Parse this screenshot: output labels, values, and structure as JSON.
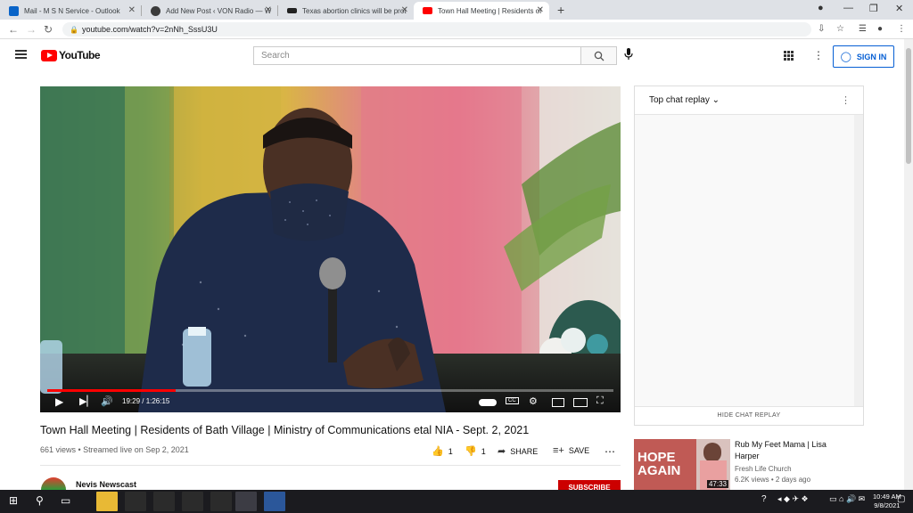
{
  "browser": {
    "tabs": [
      {
        "title": "Mail - M S N Service - Outlook",
        "color": "#0a64c8",
        "active": false
      },
      {
        "title": "Add New Post ‹ VON Radio — W",
        "color": "#3b3b3b",
        "active": false
      },
      {
        "title": "Texas abortion clinics will be prot",
        "color": "#222222",
        "active": false
      },
      {
        "title": "Town Hall Meeting | Residents of",
        "color": "#ff0000",
        "active": true
      }
    ],
    "url": "youtube.com/watch?v=2nNh_SssU3U"
  },
  "youtube": {
    "logo_text": "YouTube",
    "search_placeholder": "Search",
    "signin_label": "SIGN IN"
  },
  "player": {
    "time_display": "19:29 / 1:26:15",
    "progress": 0.226
  },
  "video": {
    "title": "Town Hall Meeting | Residents of Bath Village | Ministry of Communications etal NIA - Sept. 2, 2021",
    "meta": "661 views • Streamed live on Sep 2, 2021",
    "likes": "1",
    "dislikes": "1",
    "share_label": "SHARE",
    "save_label": "SAVE"
  },
  "channel": {
    "name": "Nevis Newscast",
    "subscribe_label": "SUBSCRIBE"
  },
  "chat": {
    "title": "Top chat replay",
    "footer": "HIDE CHAT REPLAY"
  },
  "recommended": [
    {
      "title": "Rub My Feet Mama | Lisa Harper",
      "channel": "Fresh Life Church",
      "meta": "6.2K views • 2 days ago",
      "duration": "47:33",
      "thumb_text_1": "HOPE",
      "thumb_text_2": "AGAIN"
    }
  ],
  "taskbar": {
    "time": "10:49 AM",
    "date": "9/8/2021"
  }
}
